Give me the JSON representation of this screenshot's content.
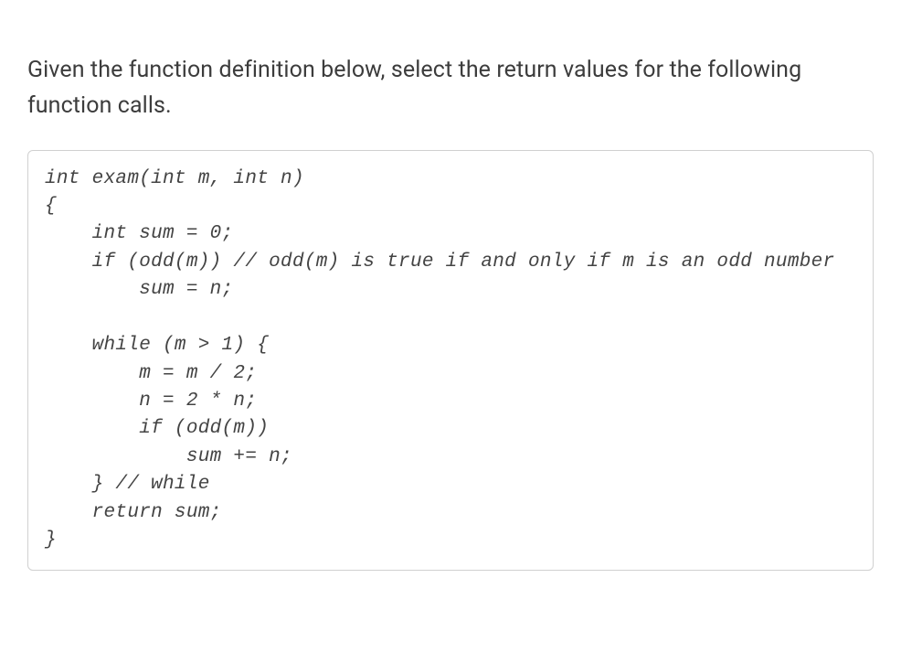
{
  "question": {
    "prompt": "Given the function definition below, select the return values for the following function calls."
  },
  "code": {
    "text": "int exam(int m, int n)\n{\n    int sum = 0;\n    if (odd(m)) // odd(m) is true if and only if m is an odd number\n        sum = n;\n\n    while (m > 1) {\n        m = m / 2;\n        n = 2 * n;\n        if (odd(m))\n            sum += n;\n    } // while\n    return sum;\n}"
  }
}
